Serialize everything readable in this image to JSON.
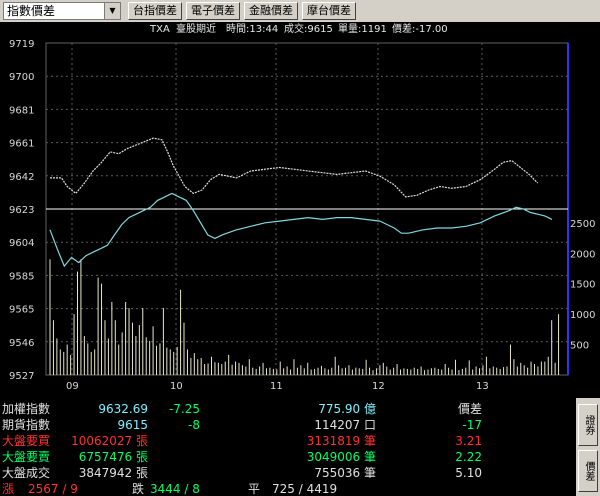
{
  "toolbar": {
    "select_value": "指數價差",
    "arrow": "▼",
    "buttons": [
      "台指價差",
      "電子價差",
      "金融價差",
      "摩台價差"
    ]
  },
  "header": {
    "symbol": "TXA",
    "title": "臺股期近",
    "time": "時間:13:44",
    "deal": "成交:9615",
    "volume": "單量:1191",
    "spread": "價差:-17.00"
  },
  "chart_data": {
    "type": "line",
    "y_ticks": [
      "9719",
      "9700",
      "9681",
      "9661",
      "9642",
      "9623",
      "9604",
      "9585",
      "9565",
      "9546",
      "9527"
    ],
    "y_range": [
      9527,
      9719
    ],
    "reference_line": 9623,
    "volume_ticks": [
      "2500",
      "2000",
      "1500",
      "1000",
      "500"
    ],
    "volume_range": [
      0,
      3000
    ],
    "x_ticks": [
      "09",
      "10",
      "11",
      "12",
      "13"
    ],
    "colors": {
      "futures": "#7fd8e0",
      "index": "#e0e0e0",
      "volume": "#e8e8c8",
      "reference": "#ffffff",
      "top_label": "#ff4040",
      "bottom_label": "#00e060",
      "grid": "#5a5a5a",
      "right_axis": "#3030ff"
    },
    "futures_series": [
      [
        0,
        9611
      ],
      [
        5,
        9600
      ],
      [
        10,
        9590
      ],
      [
        15,
        9595
      ],
      [
        20,
        9592
      ],
      [
        25,
        9596
      ],
      [
        30,
        9598
      ],
      [
        35,
        9600
      ],
      [
        40,
        9602
      ],
      [
        45,
        9608
      ],
      [
        50,
        9614
      ],
      [
        55,
        9618
      ],
      [
        60,
        9620
      ],
      [
        65,
        9622
      ],
      [
        70,
        9624
      ],
      [
        75,
        9628
      ],
      [
        80,
        9630
      ],
      [
        85,
        9632
      ],
      [
        90,
        9630
      ],
      [
        95,
        9628
      ],
      [
        100,
        9622
      ],
      [
        105,
        9615
      ],
      [
        110,
        9608
      ],
      [
        115,
        9606
      ],
      [
        120,
        9608
      ],
      [
        130,
        9611
      ],
      [
        140,
        9613
      ],
      [
        150,
        9615
      ],
      [
        160,
        9616
      ],
      [
        170,
        9617
      ],
      [
        180,
        9618
      ],
      [
        190,
        9617
      ],
      [
        200,
        9618
      ],
      [
        210,
        9618
      ],
      [
        220,
        9617
      ],
      [
        230,
        9616
      ],
      [
        240,
        9612
      ],
      [
        245,
        9609
      ],
      [
        250,
        9609
      ],
      [
        260,
        9611
      ],
      [
        270,
        9612
      ],
      [
        280,
        9612
      ],
      [
        290,
        9613
      ],
      [
        300,
        9615
      ],
      [
        310,
        9619
      ],
      [
        320,
        9622
      ],
      [
        325,
        9624
      ],
      [
        330,
        9623
      ],
      [
        335,
        9621
      ],
      [
        340,
        9620
      ],
      [
        345,
        9619
      ],
      [
        350,
        9617
      ]
    ],
    "index_series": [
      [
        0,
        9641
      ],
      [
        8,
        9641
      ],
      [
        12,
        9636
      ],
      [
        18,
        9632
      ],
      [
        24,
        9638
      ],
      [
        30,
        9645
      ],
      [
        36,
        9650
      ],
      [
        42,
        9656
      ],
      [
        48,
        9655
      ],
      [
        54,
        9658
      ],
      [
        60,
        9660
      ],
      [
        66,
        9662
      ],
      [
        72,
        9664
      ],
      [
        78,
        9663
      ],
      [
        82,
        9656
      ],
      [
        86,
        9648
      ],
      [
        90,
        9642
      ],
      [
        94,
        9636
      ],
      [
        100,
        9632
      ],
      [
        106,
        9634
      ],
      [
        112,
        9640
      ],
      [
        118,
        9643
      ],
      [
        124,
        9642
      ],
      [
        130,
        9641
      ],
      [
        140,
        9645
      ],
      [
        150,
        9646
      ],
      [
        160,
        9647
      ],
      [
        170,
        9646
      ],
      [
        180,
        9645
      ],
      [
        190,
        9644
      ],
      [
        200,
        9643
      ],
      [
        210,
        9644
      ],
      [
        220,
        9645
      ],
      [
        230,
        9642
      ],
      [
        240,
        9637
      ],
      [
        248,
        9630
      ],
      [
        256,
        9631
      ],
      [
        264,
        9634
      ],
      [
        272,
        9636
      ],
      [
        280,
        9635
      ],
      [
        290,
        9636
      ],
      [
        300,
        9640
      ],
      [
        305,
        9643
      ],
      [
        310,
        9646
      ],
      [
        316,
        9650
      ],
      [
        322,
        9651
      ],
      [
        328,
        9647
      ],
      [
        334,
        9643
      ],
      [
        340,
        9638
      ]
    ],
    "volume_bars": [
      1900,
      900,
      600,
      420,
      380,
      500,
      330,
      1000,
      1700,
      1900,
      640,
      520,
      380,
      420,
      1600,
      1500,
      900,
      600,
      1200,
      900,
      500,
      700,
      1200,
      1100,
      860,
      640,
      820,
      1100,
      620,
      560,
      800,
      480,
      520,
      1100,
      450,
      420,
      380,
      460,
      1400,
      860,
      420,
      280,
      360,
      260,
      280,
      180,
      190,
      300,
      210,
      200,
      180,
      220,
      330,
      170,
      220,
      200,
      160,
      140,
      260,
      120,
      100,
      140,
      200,
      110,
      120,
      100,
      90,
      220,
      110,
      140,
      90,
      260,
      120,
      160,
      110,
      200,
      90,
      100,
      120,
      150,
      110,
      90,
      120,
      300,
      160,
      110,
      120,
      160,
      90,
      120,
      110,
      100,
      250,
      120,
      80,
      110,
      160,
      200,
      140,
      90,
      120,
      180,
      90,
      110,
      100,
      90,
      120,
      100,
      140,
      80,
      90,
      110,
      120,
      100,
      90,
      180,
      120,
      90,
      250,
      80,
      100,
      120,
      240,
      90,
      140,
      110,
      160,
      300,
      110,
      140,
      120,
      100,
      130,
      140,
      500,
      260,
      140,
      200,
      160,
      120,
      220,
      180,
      140,
      220,
      220,
      300,
      900,
      200,
      1000
    ]
  },
  "panel": {
    "rows": [
      {
        "c": [
          {
            "t": "加權指數",
            "col": "#e0e0e0"
          },
          {
            "t": "9632.69",
            "col": "#80f0ff"
          },
          {
            "t": "-7.25",
            "col": "#00ff66"
          },
          {
            "t": "775.90 億",
            "col": "#80f0ff"
          },
          {
            "t": "價差",
            "col": "#e0e0e0"
          }
        ]
      },
      {
        "c": [
          {
            "t": "期貨指數",
            "col": "#e0e0e0"
          },
          {
            "t": "9615",
            "col": "#80f0ff"
          },
          {
            "t": "-8",
            "col": "#00ff66"
          },
          {
            "t": "114207 口",
            "col": "#e0e0e0"
          },
          {
            "t": "-17",
            "col": "#00ff66"
          }
        ]
      },
      {
        "c": [
          {
            "t": "大盤要買",
            "col": "#ff3030"
          },
          {
            "t": "10062027 張",
            "col": "#ff3030"
          },
          {
            "t": "",
            "col": "#ff3030"
          },
          {
            "t": "3131819 筆",
            "col": "#ff3030"
          },
          {
            "t": "3.21",
            "col": "#ff3030"
          }
        ]
      },
      {
        "c": [
          {
            "t": "大盤要賣",
            "col": "#00ff66"
          },
          {
            "t": "6757476 張",
            "col": "#00ff66"
          },
          {
            "t": "",
            "col": "#00ff66"
          },
          {
            "t": "3049006 筆",
            "col": "#00ff66"
          },
          {
            "t": "2.22",
            "col": "#00ff66"
          }
        ]
      },
      {
        "c": [
          {
            "t": "大盤成交",
            "col": "#e0e0e0"
          },
          {
            "t": "3847942 張",
            "col": "#e0e0e0"
          },
          {
            "t": "",
            "col": "#e0e0e0"
          },
          {
            "t": "755036 筆",
            "col": "#e0e0e0"
          },
          {
            "t": "5.10",
            "col": "#e0e0e0"
          }
        ]
      }
    ],
    "last_row": {
      "up_label": "漲",
      "up_value": "2567 / 9",
      "down_label": "跌",
      "down_value": "3444 / 8",
      "flat_label": "平",
      "flat_value": "725 / 4419"
    }
  },
  "side_tabs": [
    "證券",
    "價差"
  ]
}
